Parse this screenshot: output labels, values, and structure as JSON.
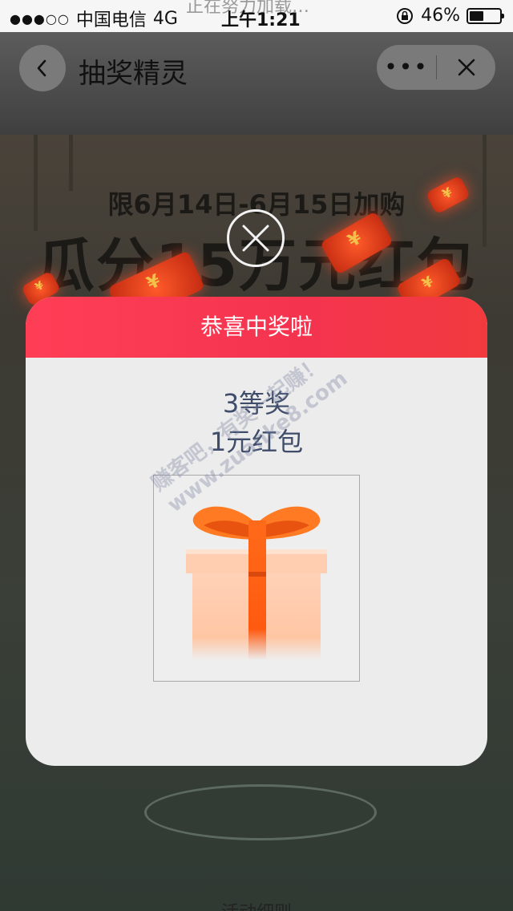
{
  "status_bar": {
    "signal": "●●●○○",
    "carrier": "中国电信",
    "network": "4G",
    "time": "上午1:21",
    "loading_text": "正在努力加载…",
    "battery": "46%",
    "battery_level": 0.46
  },
  "nav": {
    "title": "抽奖精灵",
    "more_label": "•••"
  },
  "promo": {
    "line1": "限6月14日-6月15日加购",
    "line2": "瓜分15万元红包",
    "rules_link": "活动细则"
  },
  "modal": {
    "header": "恭喜中奖啦",
    "prize_level": "3等奖",
    "prize_name": "1元红包"
  },
  "watermark": {
    "line1": "赚客吧，有奖一起赚！",
    "line2": "www.zuanke8.com"
  },
  "colors": {
    "header_red": "#f4344f",
    "prize_text": "#3f4d6a",
    "gift_orange": "#ff6a1a"
  }
}
